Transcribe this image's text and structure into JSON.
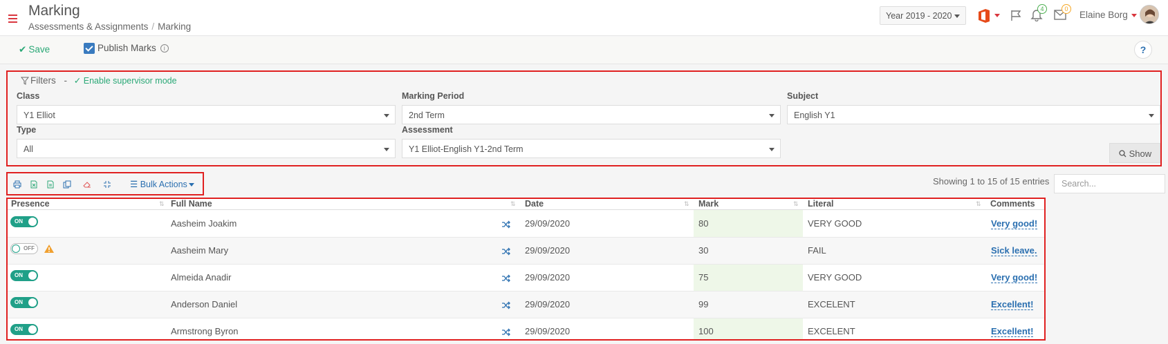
{
  "header": {
    "title": "Marking",
    "breadcrumb": [
      "Assessments & Assignments",
      "/",
      "Marking"
    ],
    "year_select": "Year 2019 - 2020",
    "notifications_count": "4",
    "messages_count": "0",
    "user_name": "Elaine Borg"
  },
  "toolbar": {
    "save_label": "Save",
    "publish_label": "Publish Marks",
    "publish_checked": true,
    "help_label": "?"
  },
  "filters": {
    "title": "Filters",
    "dash": "-",
    "supervisor_label": "Enable supervisor mode",
    "class": {
      "label": "Class",
      "value": "Y1 Elliot"
    },
    "marking_period": {
      "label": "Marking Period",
      "value": "2nd Term"
    },
    "subject": {
      "label": "Subject",
      "value": "English Y1"
    },
    "type": {
      "label": "Type",
      "value": "All"
    },
    "assessment": {
      "label": "Assessment",
      "value": "Y1 Elliot-English Y1-2nd Term"
    },
    "show_label": "Show"
  },
  "table_tools": {
    "bulk_actions_label": "Bulk Actions",
    "entries_text": "Showing 1 to 15 of 15 entries",
    "search_placeholder": "Search..."
  },
  "table": {
    "columns": [
      "Presence",
      "Full Name",
      "Date",
      "Mark",
      "Literal",
      "Comments"
    ],
    "rows": [
      {
        "presence": "ON",
        "full_name": "Aasheim Joakim",
        "date": "29/09/2020",
        "mark": "80",
        "literal": "VERY GOOD",
        "comment": "Very good!"
      },
      {
        "presence": "OFF",
        "full_name": "Aasheim Mary",
        "date": "29/09/2020",
        "mark": "30",
        "literal": "FAIL",
        "comment": "Sick leave."
      },
      {
        "presence": "ON",
        "full_name": "Almeida Anadir",
        "date": "29/09/2020",
        "mark": "75",
        "literal": "VERY GOOD",
        "comment": "Very good!"
      },
      {
        "presence": "ON",
        "full_name": "Anderson Daniel",
        "date": "29/09/2020",
        "mark": "99",
        "literal": "EXCELENT",
        "comment": "Excellent!"
      },
      {
        "presence": "ON",
        "full_name": "Armstrong Byron",
        "date": "29/09/2020",
        "mark": "100",
        "literal": "EXCELENT",
        "comment": "Excellent!"
      }
    ]
  },
  "colors": {
    "accent_red": "#d9363e",
    "accent_green": "#2aa876",
    "link_blue": "#2a6fb0",
    "toggle_on": "#20a088",
    "highlight_border": "#e02020"
  }
}
